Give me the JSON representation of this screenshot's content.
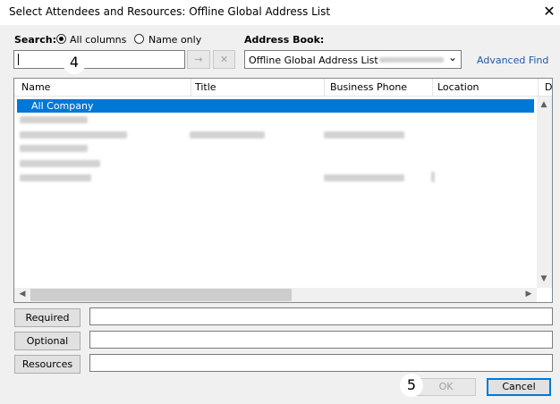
{
  "window": {
    "title": "Select Attendees and Resources: Offline Global Address List",
    "close_glyph": "✕"
  },
  "search": {
    "label": "Search:",
    "options": [
      {
        "label": "All columns",
        "selected": true
      },
      {
        "label": "Name only",
        "selected": false
      }
    ],
    "input_value": "",
    "go_glyph": "→",
    "clear_glyph": "✕"
  },
  "address_book": {
    "label": "Address Book:",
    "selected": "Offline Global Address List -",
    "chevron": "⌄",
    "advanced_find": "Advanced Find"
  },
  "list": {
    "columns": [
      "Name",
      "Title",
      "Business Phone",
      "Location",
      "D"
    ],
    "selected_row": "All Company",
    "scroll_up": "▲",
    "scroll_down": "▼",
    "scroll_left": "◀",
    "scroll_right": "▶"
  },
  "recipients": {
    "required": {
      "label": "Required",
      "value": ""
    },
    "optional": {
      "label": "Optional",
      "value": ""
    },
    "resources": {
      "label": "Resources",
      "value": ""
    }
  },
  "footer": {
    "ok": "OK",
    "cancel": "Cancel"
  },
  "annotations": {
    "badge4": "4",
    "badge5": "5"
  }
}
